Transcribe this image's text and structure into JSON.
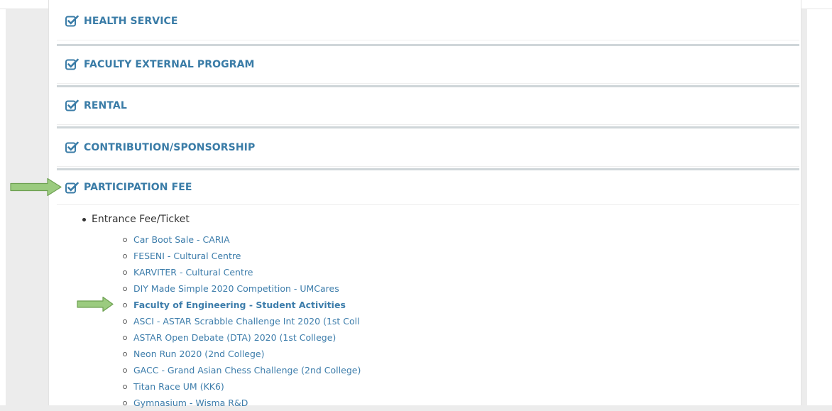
{
  "sections": [
    {
      "title": "HEALTH SERVICE"
    },
    {
      "title": "FACULTY EXTERNAL PROGRAM"
    },
    {
      "title": "RENTAL"
    },
    {
      "title": "CONTRIBUTION/SPONSORSHIP"
    },
    {
      "title": "PARTICIPATION FEE"
    }
  ],
  "participation": {
    "category": "Entrance Fee/Ticket",
    "items": [
      "Car Boot Sale - CARIA",
      "FESENI - Cultural Centre",
      "KARVITER - Cultural Centre",
      "DIY Made Simple 2020 Competition - UMCares",
      "Faculty of Engineering - Student Activities",
      "ASCI - ASTAR Scrabble Challenge Int 2020 (1st Coll",
      "ASTAR Open Debate (DTA) 2020 (1st College)",
      "Neon Run 2020 (2nd College)",
      "GACC - Grand Asian Chess Challenge (2nd College)",
      "Titan Race UM (KK6)",
      "Gymnasium - Wisma R&D"
    ]
  },
  "colors": {
    "accent": "#3a7ca7",
    "link": "#3d7dab",
    "arrow_fill": "#9bcb7f",
    "arrow_stroke": "#6ea152"
  },
  "icons": {
    "section_header": "checkbox-check-icon",
    "annotation": "green-arrow-icon"
  }
}
